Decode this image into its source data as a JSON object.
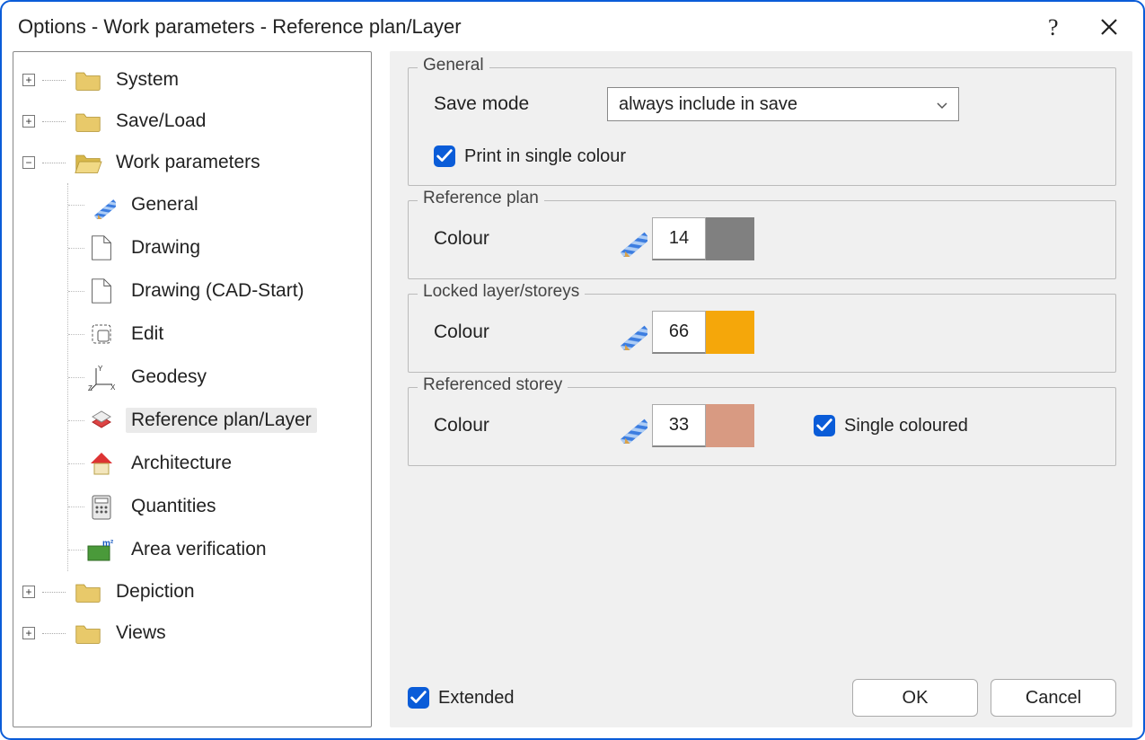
{
  "window": {
    "title": "Options - Work parameters - Reference plan/Layer"
  },
  "tree": {
    "system": "System",
    "saveload": "Save/Load",
    "workparams": "Work parameters",
    "wp_general": "General",
    "wp_drawing": "Drawing",
    "wp_drawing_cad": "Drawing (CAD-Start)",
    "wp_edit": "Edit",
    "wp_geodesy": "Geodesy",
    "wp_refplan": "Reference plan/Layer",
    "wp_architecture": "Architecture",
    "wp_quantities": "Quantities",
    "wp_areaverif": "Area verification",
    "depiction": "Depiction",
    "views": "Views"
  },
  "panel": {
    "general": {
      "legend": "General",
      "save_mode_label": "Save mode",
      "save_mode_value": "always include in save",
      "print_single": "Print in single colour"
    },
    "refplan": {
      "legend": "Reference plan",
      "colour_label": "Colour",
      "colour_value": "14",
      "colour_hex": "#808080"
    },
    "locked": {
      "legend": "Locked layer/storeys",
      "colour_label": "Colour",
      "colour_value": "66",
      "colour_hex": "#f5a70a"
    },
    "refstorey": {
      "legend": "Referenced storey",
      "colour_label": "Colour",
      "colour_value": "33",
      "colour_hex": "#d89a82",
      "single_coloured": "Single coloured"
    },
    "footer": {
      "extended": "Extended",
      "ok": "OK",
      "cancel": "Cancel"
    }
  }
}
